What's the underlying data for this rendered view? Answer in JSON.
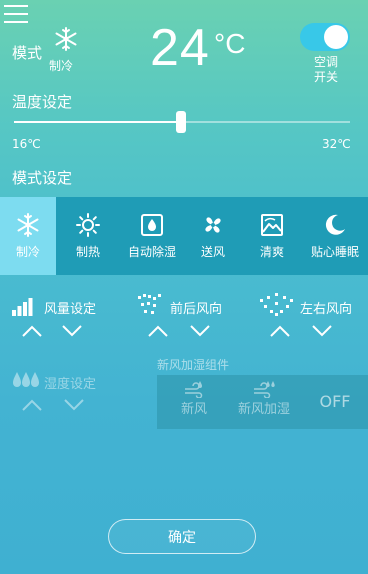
{
  "header": {
    "mode_label": "模式",
    "current_mode": "制冷",
    "temperature": "24",
    "unit": "°C",
    "ac_switch_line1": "空调",
    "ac_switch_line2": "开关",
    "ac_on": true
  },
  "temp_setting": {
    "title": "温度设定",
    "min": "16℃",
    "max": "32℃",
    "value_fraction": 0.5
  },
  "mode_setting": {
    "title": "模式设定",
    "modes": [
      {
        "label": "制冷",
        "icon": "snowflake-icon",
        "active": true
      },
      {
        "label": "制热",
        "icon": "sun-icon",
        "active": false
      },
      {
        "label": "自动除湿",
        "icon": "water-drop-icon",
        "active": false
      },
      {
        "label": "送风",
        "icon": "fan-icon",
        "active": false
      },
      {
        "label": "清爽",
        "icon": "mountain-icon",
        "active": false
      },
      {
        "label": "贴心睡眠",
        "icon": "moon-icon",
        "active": false
      }
    ]
  },
  "controls": {
    "fan_speed": "风量设定",
    "front_back_wind": "前后风向",
    "left_right_wind": "左右风向",
    "humidity": "湿度设定"
  },
  "fresh_air": {
    "title": "新风加湿组件",
    "fresh": "新风",
    "fresh_humidify": "新风加湿",
    "off": "OFF"
  },
  "confirm": "确定",
  "colors": {
    "mode_bar": "#1f9cb6",
    "active_mode": "#7ddcf0",
    "toggle_on": "#38c8e8"
  }
}
